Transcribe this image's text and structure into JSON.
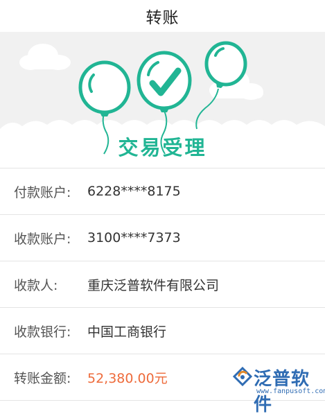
{
  "header": {
    "title": "转账"
  },
  "banner": {
    "status_text": "交易受理"
  },
  "rows": [
    {
      "label": "付款账户:",
      "value": "6228****8175"
    },
    {
      "label": "收款账户:",
      "value": "3100****7373"
    },
    {
      "label": "收款人:",
      "value": "重庆泛普软件有限公司"
    },
    {
      "label": "收款银行:",
      "value": "中国工商银行"
    },
    {
      "label": "转账金额:",
      "value": "52,380.00元"
    }
  ],
  "watermark": {
    "brand": "泛普软件",
    "url": "www.fanpusoft.com"
  },
  "colors": {
    "accent": "#21b594",
    "amount": "#ee6b3b",
    "brand": "#2f6cb3"
  }
}
